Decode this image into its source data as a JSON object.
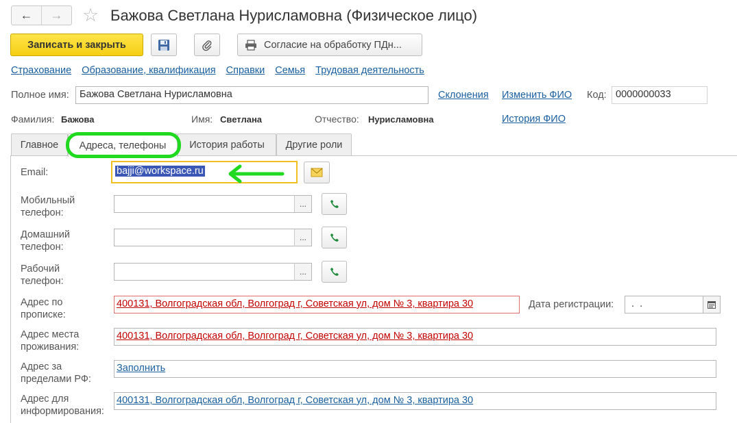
{
  "window": {
    "title": "Бажова Светлана Нурисламовна (Физическое лицо)",
    "back_icon": "←",
    "forward_icon": "→",
    "star_icon": "☆"
  },
  "toolbar": {
    "save_close_label": "Записать и закрыть",
    "print_label": "Согласие на обработку ПДн..."
  },
  "links": [
    "Страхование",
    "Образование, квалификация",
    "Справки",
    "Семья",
    "Трудовая деятельность"
  ],
  "fullname": {
    "label": "Полное имя:",
    "value": "Бажова Светлана Нурисламовна",
    "declensions_link": "Склонения",
    "change_fio_link": "Изменить ФИО",
    "code_label": "Код:",
    "code_value": "0000000033"
  },
  "fio": {
    "surname_label": "Фамилия:",
    "surname_value": "Бажова",
    "name_label": "Имя:",
    "name_value": "Светлана",
    "patronymic_label": "Отчество:",
    "patronymic_value": "Нурисламовна",
    "history_link": "История ФИО"
  },
  "tabs": [
    "Главное",
    "Адреса, телефоны",
    "История работы",
    "Другие роли"
  ],
  "contacts": {
    "email_label": "Email:",
    "email_value": "bajji@workspace.ru",
    "mobile_label_1": "Мобильный",
    "mobile_label_2": "телефон:",
    "home_label_1": "Домашний",
    "home_label_2": "телефон:",
    "work_label_1": "Рабочий",
    "work_label_2": "телефон:",
    "dots": "..."
  },
  "addresses": {
    "reg_label_1": "Адрес по",
    "reg_label_2": "прописке:",
    "reg_value": "400131, Волгоградская обл, Волгоград г, Советская ул, дом № 3, квартира 30",
    "reg_date_label": "Дата регистрации:",
    "reg_date_value": " .  .",
    "live_label_1": "Адрес места",
    "live_label_2": "проживания:",
    "live_value": "400131, Волгоградская обл, Волгоград г, Советская ул, дом № 3, квартира 30",
    "abroad_label_1": "Адрес за",
    "abroad_label_2": "пределами РФ:",
    "abroad_value": "Заполнить",
    "info_label_1": "Адрес для",
    "info_label_2": "информирования:",
    "info_value": "400131, Волгоградская обл, Волгоград г, Советская ул, дом № 3, квартира 30"
  },
  "colors": {
    "accent_yellow": "#f5cf14",
    "link_blue": "#1a5fa0",
    "highlight_green": "#22d922",
    "error_red": "#c40000",
    "selection_blue": "#3b57b5"
  }
}
